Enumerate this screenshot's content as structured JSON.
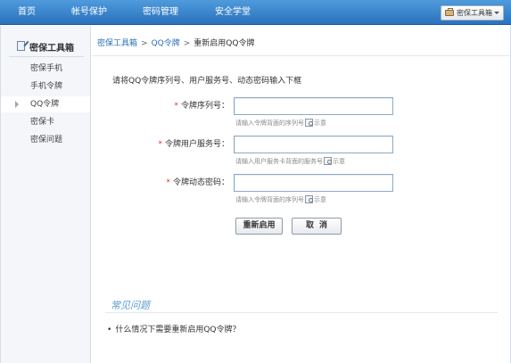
{
  "nav": {
    "items": [
      "首页",
      "帐号保护",
      "密码管理",
      "安全学堂"
    ],
    "toolbox_button": "密保工具箱"
  },
  "sidebar": {
    "title": "密保工具箱",
    "items": [
      "密保手机",
      "手机令牌",
      "QQ令牌",
      "密保卡",
      "密保问题"
    ],
    "active_index": 2
  },
  "breadcrumb": {
    "items": [
      "密保工具箱",
      "QQ令牌"
    ],
    "separator": ">",
    "current": "重新启用QQ令牌"
  },
  "form": {
    "instruction": "请将QQ令牌序列号、用户服务号、动态密码输入下框",
    "required_mark": "*",
    "fields": [
      {
        "label": "令牌序列号：",
        "value": "",
        "hint": "请输入令牌背面的序列号",
        "hint_link": "示意"
      },
      {
        "label": "令牌用户服务号：",
        "value": "",
        "hint": "请输入用户服务卡背面的服务号",
        "hint_link": "示意"
      },
      {
        "label": "令牌动态密码：",
        "value": "",
        "hint": "请输入令牌背面的序列号",
        "hint_link": "示意"
      }
    ],
    "submit_label": "重新启用",
    "cancel_label": "取消"
  },
  "faq": {
    "title": "常见问题",
    "bullet": "•",
    "items": [
      "什么情况下需要重新启用QQ令牌？"
    ]
  },
  "colors": {
    "nav_bg": "#3a85cf",
    "link": "#2a6fb7",
    "faq_title": "#5b9bd5",
    "required": "#d23a2b"
  }
}
